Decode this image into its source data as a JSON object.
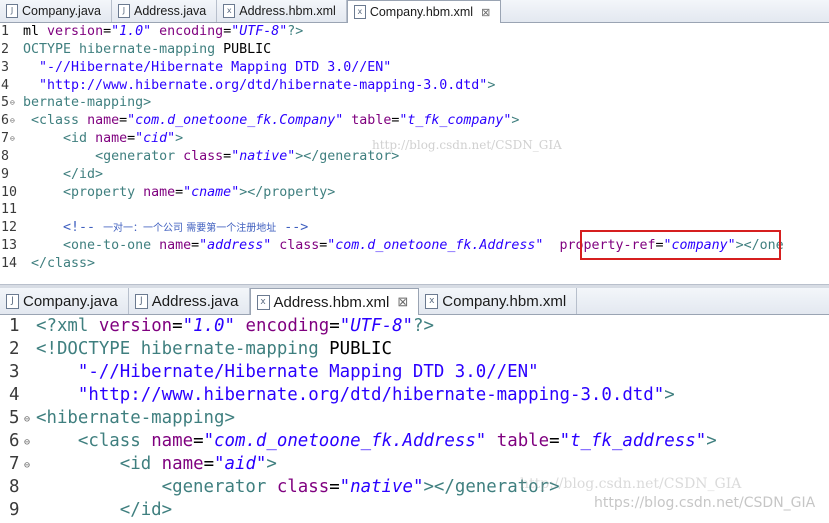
{
  "top_editor": {
    "tabs": [
      {
        "label": "Company.java",
        "icon": "java-file-icon",
        "active": false
      },
      {
        "label": "Address.java",
        "icon": "java-file-icon",
        "active": false
      },
      {
        "label": "Address.hbm.xml",
        "icon": "xml-file-icon",
        "active": false
      },
      {
        "label": "Company.hbm.xml",
        "icon": "xml-file-icon",
        "active": true,
        "close": "⊠"
      }
    ],
    "lines": [
      {
        "n": "1",
        "fold": "",
        "segs": [
          [
            "t-pl",
            "ml "
          ],
          [
            "t-attr",
            "version"
          ],
          [
            "t-pl",
            "="
          ],
          [
            "t-val",
            "\"1.0\""
          ],
          [
            "t-pl",
            " "
          ],
          [
            "t-attr",
            "encoding"
          ],
          [
            "t-pl",
            "="
          ],
          [
            "t-val",
            "\"UTF-8\""
          ],
          [
            "t-tag",
            "?>"
          ]
        ]
      },
      {
        "n": "2",
        "fold": "",
        "segs": [
          [
            "t-tag",
            "OCTYPE "
          ],
          [
            "t-tag",
            "hibernate-mapping"
          ],
          [
            "t-pl",
            " PUBLIC"
          ]
        ]
      },
      {
        "n": "3",
        "fold": "",
        "segs": [
          [
            "t-str",
            "  \"-//Hibernate/Hibernate Mapping DTD 3.0//EN\""
          ]
        ]
      },
      {
        "n": "4",
        "fold": "",
        "segs": [
          [
            "t-str",
            "  \"http://www.hibernate.org/dtd/hibernate-mapping-3.0.dtd\""
          ],
          [
            "t-tag",
            ">"
          ]
        ]
      },
      {
        "n": "5",
        "fold": "⊖",
        "segs": [
          [
            "t-tag",
            "bernate-mapping>"
          ]
        ]
      },
      {
        "n": "6",
        "fold": "⊖",
        "segs": [
          [
            "t-pl",
            " "
          ],
          [
            "t-tag",
            "<class"
          ],
          [
            "t-pl",
            " "
          ],
          [
            "t-attr",
            "name"
          ],
          [
            "t-pl",
            "="
          ],
          [
            "t-val",
            "\"com.d_onetoone_fk.Company\""
          ],
          [
            "t-pl",
            " "
          ],
          [
            "t-attr",
            "table"
          ],
          [
            "t-pl",
            "="
          ],
          [
            "t-val",
            "\"t_fk_company\""
          ],
          [
            "t-tag",
            ">"
          ]
        ]
      },
      {
        "n": "7",
        "fold": "⊖",
        "segs": [
          [
            "t-pl",
            "     "
          ],
          [
            "t-tag",
            "<id"
          ],
          [
            "t-pl",
            " "
          ],
          [
            "t-attr",
            "name"
          ],
          [
            "t-pl",
            "="
          ],
          [
            "t-val",
            "\"cid\""
          ],
          [
            "t-tag",
            ">"
          ]
        ]
      },
      {
        "n": "8",
        "fold": "",
        "segs": [
          [
            "t-pl",
            "         "
          ],
          [
            "t-tag",
            "<generator"
          ],
          [
            "t-pl",
            " "
          ],
          [
            "t-attr",
            "class"
          ],
          [
            "t-pl",
            "="
          ],
          [
            "t-val",
            "\"native\""
          ],
          [
            "t-tag",
            "></generator>"
          ]
        ]
      },
      {
        "n": "9",
        "fold": "",
        "segs": [
          [
            "t-pl",
            "     "
          ],
          [
            "t-tag",
            "</id>"
          ]
        ]
      },
      {
        "n": "10",
        "fold": "",
        "segs": [
          [
            "t-pl",
            "     "
          ],
          [
            "t-tag",
            "<property"
          ],
          [
            "t-pl",
            " "
          ],
          [
            "t-attr",
            "name"
          ],
          [
            "t-pl",
            "="
          ],
          [
            "t-val",
            "\"cname\""
          ],
          [
            "t-tag",
            "></property>"
          ]
        ]
      },
      {
        "n": "11",
        "fold": "",
        "segs": [
          [
            "t-pl",
            ""
          ]
        ]
      },
      {
        "n": "12",
        "fold": "",
        "segs": [
          [
            "t-pl",
            "     "
          ],
          [
            "t-com",
            "<!-- "
          ],
          [
            "t-com-cn",
            "一对一：一个公司 需要第一个注册地址"
          ],
          [
            "t-com",
            " -->"
          ]
        ]
      },
      {
        "n": "13",
        "fold": "",
        "segs": [
          [
            "t-pl",
            "     "
          ],
          [
            "t-tag",
            "<one-to-one"
          ],
          [
            "t-pl",
            " "
          ],
          [
            "t-attr",
            "name"
          ],
          [
            "t-pl",
            "="
          ],
          [
            "t-val",
            "\"address\""
          ],
          [
            "t-pl",
            " "
          ],
          [
            "t-attr",
            "class"
          ],
          [
            "t-pl",
            "="
          ],
          [
            "t-val",
            "\"com.d_onetoone_fk.Address\""
          ],
          [
            "t-pl",
            "  "
          ],
          [
            "t-attr",
            "property-ref"
          ],
          [
            "t-pl",
            "="
          ],
          [
            "t-val",
            "\"company\""
          ],
          [
            "t-tag",
            "></one"
          ]
        ]
      },
      {
        "n": "14",
        "fold": "",
        "segs": [
          [
            "t-pl",
            " "
          ],
          [
            "t-tag",
            "</class>"
          ]
        ]
      }
    ]
  },
  "bottom_editor": {
    "tabs": [
      {
        "label": "Company.java",
        "icon": "java-file-icon",
        "active": false
      },
      {
        "label": "Address.java",
        "icon": "java-file-icon",
        "active": false
      },
      {
        "label": "Address.hbm.xml",
        "icon": "xml-file-icon",
        "active": true,
        "close": "⊠"
      },
      {
        "label": "Company.hbm.xml",
        "icon": "xml-file-icon",
        "active": false
      }
    ],
    "lines": [
      {
        "n": "1",
        "fold": "",
        "segs": [
          [
            "t-tag",
            "<?xml"
          ],
          [
            "t-pl",
            " "
          ],
          [
            "t-attr",
            "version"
          ],
          [
            "t-pl",
            "="
          ],
          [
            "t-val",
            "\"1.0\""
          ],
          [
            "t-pl",
            " "
          ],
          [
            "t-attr",
            "encoding"
          ],
          [
            "t-pl",
            "="
          ],
          [
            "t-val",
            "\"UTF-8\""
          ],
          [
            "t-tag",
            "?>"
          ]
        ]
      },
      {
        "n": "2",
        "fold": "",
        "segs": [
          [
            "t-tag",
            "<!DOCTYPE "
          ],
          [
            "t-tag",
            "hibernate-mapping"
          ],
          [
            "t-pl",
            " PUBLIC"
          ]
        ]
      },
      {
        "n": "3",
        "fold": "",
        "segs": [
          [
            "t-str",
            "    \"-//Hibernate/Hibernate Mapping DTD 3.0//EN\""
          ]
        ]
      },
      {
        "n": "4",
        "fold": "",
        "segs": [
          [
            "t-str",
            "    \"http://www.hibernate.org/dtd/hibernate-mapping-3.0.dtd\""
          ],
          [
            "t-tag",
            ">"
          ]
        ]
      },
      {
        "n": "5",
        "fold": "⊖",
        "segs": [
          [
            "t-tag",
            "<hibernate-mapping>"
          ]
        ]
      },
      {
        "n": "6",
        "fold": "⊖",
        "segs": [
          [
            "t-pl",
            "    "
          ],
          [
            "t-tag",
            "<class"
          ],
          [
            "t-pl",
            " "
          ],
          [
            "t-attr",
            "name"
          ],
          [
            "t-pl",
            "="
          ],
          [
            "t-val",
            "\"com.d_onetoone_fk.Address\""
          ],
          [
            "t-pl",
            " "
          ],
          [
            "t-attr",
            "table"
          ],
          [
            "t-pl",
            "="
          ],
          [
            "t-val",
            "\"t_fk_address\""
          ],
          [
            "t-tag",
            ">"
          ]
        ]
      },
      {
        "n": "7",
        "fold": "⊖",
        "segs": [
          [
            "t-pl",
            "        "
          ],
          [
            "t-tag",
            "<id"
          ],
          [
            "t-pl",
            " "
          ],
          [
            "t-attr",
            "name"
          ],
          [
            "t-pl",
            "="
          ],
          [
            "t-val",
            "\"aid\""
          ],
          [
            "t-tag",
            ">"
          ]
        ]
      },
      {
        "n": "8",
        "fold": "",
        "segs": [
          [
            "t-pl",
            "            "
          ],
          [
            "t-tag",
            "<generator"
          ],
          [
            "t-pl",
            " "
          ],
          [
            "t-attr",
            "class"
          ],
          [
            "t-pl",
            "="
          ],
          [
            "t-val",
            "\"native\""
          ],
          [
            "t-tag",
            "></generator>"
          ]
        ]
      },
      {
        "n": "9",
        "fold": "",
        "segs": [
          [
            "t-pl",
            "        "
          ],
          [
            "t-tag",
            "</id>"
          ]
        ]
      }
    ]
  },
  "watermarks": {
    "top": "http://blog.csdn.net/CSDN_GIA",
    "bottom": "https://blog.csdn.net/CSDN_GIA",
    "bottom_faint": "http://blog.csdn.net/CSDN_GIA"
  },
  "colors": {
    "tag": "#3f7f7f",
    "attribute": "#7f007f",
    "value": "#2a00ff",
    "comment": "#3f5fbf",
    "highlight_box": "#d61f1f"
  }
}
